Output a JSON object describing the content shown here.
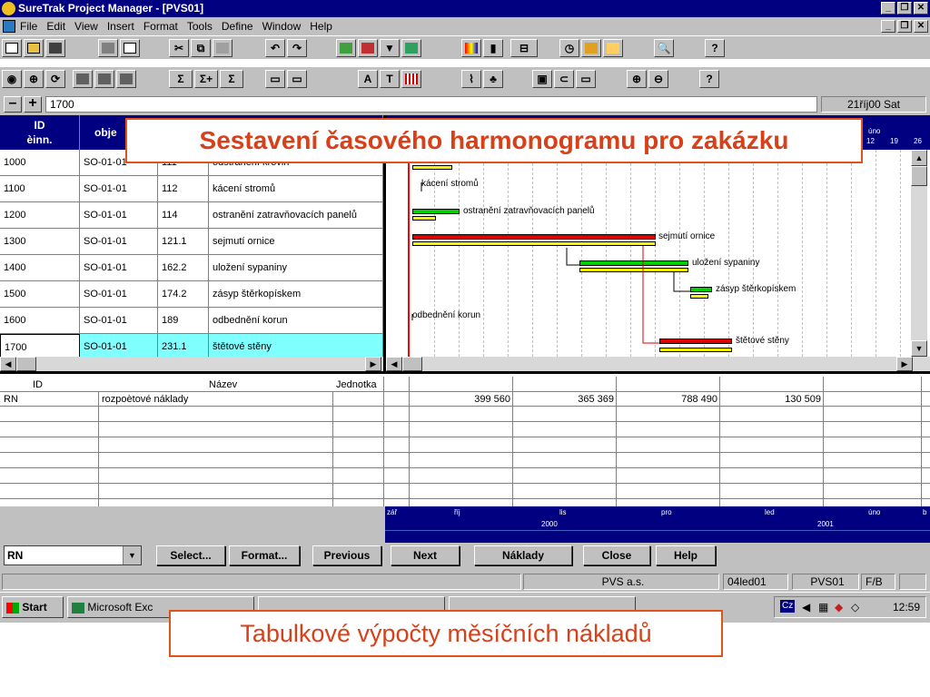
{
  "window": {
    "title": "SureTrak Project Manager - [PVS01]"
  },
  "menu": [
    "File",
    "Edit",
    "View",
    "Insert",
    "Format",
    "Tools",
    "Define",
    "Window",
    "Help"
  ],
  "editbar": {
    "minus": "–",
    "plus": "+",
    "value": "1700",
    "date": "21říj00 Sat"
  },
  "grid": {
    "headers": {
      "id": "ID\nèinn.",
      "obj": "obje"
    },
    "rows": [
      {
        "id": "1000",
        "obj": "SO-01-01",
        "code": "111",
        "name": "odstranění křovin"
      },
      {
        "id": "1100",
        "obj": "SO-01-01",
        "code": "112",
        "name": "kácení stromů"
      },
      {
        "id": "1200",
        "obj": "SO-01-01",
        "code": "114",
        "name": "ostranění zatravňovacích panelů"
      },
      {
        "id": "1300",
        "obj": "SO-01-01",
        "code": "121.1",
        "name": "sejmutí ornice"
      },
      {
        "id": "1400",
        "obj": "SO-01-01",
        "code": "162.2",
        "name": "uložení sypaniny"
      },
      {
        "id": "1500",
        "obj": "SO-01-01",
        "code": "174.2",
        "name": "zásyp štěrkopískem"
      },
      {
        "id": "1600",
        "obj": "SO-01-01",
        "code": "189",
        "name": "odbednění korun"
      },
      {
        "id": "1700",
        "obj": "SO-01-01",
        "code": "231.1",
        "name": "štětové stěny"
      }
    ]
  },
  "gantt": {
    "header_month": "úno",
    "header_days": [
      "12",
      "19",
      "26"
    ],
    "labels": {
      "l1100": "kácení stromů",
      "l1200": "ostranění zatravňovacích panelů",
      "l1300": "sejmutí ornice",
      "l1400": "uložení sypaniny",
      "l1500": "zásyp štěrkopískem",
      "l1600": "odbednění korun",
      "l1700": "štětové stěny"
    }
  },
  "sheet": {
    "headers": {
      "id": "ID",
      "name": "Název",
      "unit": "Jednotka"
    },
    "row": {
      "id": "RN",
      "name": "rozpoètové náklady",
      "v1": "399 560",
      "v2": "365 369",
      "v3": "788 490",
      "v4": "130 509"
    }
  },
  "timeline": {
    "months": [
      "zář",
      "říj",
      "lis",
      "pro",
      "led",
      "úno",
      "b"
    ],
    "years": [
      "2000",
      "2001"
    ]
  },
  "buttons": {
    "combo": "RN",
    "select": "Select...",
    "format": "Format...",
    "previous": "Previous",
    "next": "Next",
    "naklady": "Náklady",
    "close": "Close",
    "help": "Help"
  },
  "status": {
    "company": "PVS a.s.",
    "date": "04led01",
    "project": "PVS01",
    "mode": "F/B"
  },
  "taskbar": {
    "start": "Start",
    "excel": "Microsoft Exc",
    "clock": "12:59",
    "lang": "Cz"
  },
  "callouts": {
    "top": "Sestavení časového harmonogramu pro zakázku",
    "bottom": "Tabulkové výpočty měsíčních nákladů"
  },
  "colors": {
    "titlebar": "#000080",
    "bar_green": "#00d000",
    "bar_red": "#e00000",
    "bar_yellow": "#f8f800",
    "callout": "#e0541c",
    "selected_row": "#80ffff"
  }
}
